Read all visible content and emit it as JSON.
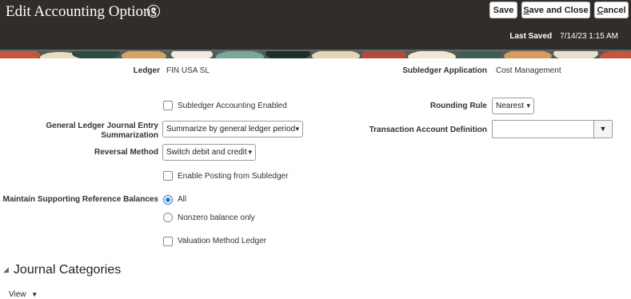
{
  "header": {
    "title": "Edit Accounting Options",
    "help_glyph": "?",
    "save": "Save",
    "save_close_accel": "S",
    "save_close_rest": "ave and Close",
    "cancel_accel": "C",
    "cancel_rest": "ancel",
    "last_saved_label": "Last Saved",
    "last_saved_value": "7/14/23 1:15 AM"
  },
  "form": {
    "ledger_label": "Ledger",
    "ledger_value": "FIN USA SL",
    "subledger_app_label": "Subledger Application",
    "subledger_app_value": "Cost Management",
    "subledger_accounting_enabled": "Subledger Accounting Enabled",
    "gl_summarization_label_1": "General Ledger Journal Entry",
    "gl_summarization_label_2": "Summarization",
    "gl_summarization_value": "Summarize by general ledger period",
    "reversal_method_label": "Reversal Method",
    "reversal_method_value": "Switch debit and credit",
    "enable_posting": "Enable Posting from Subledger",
    "maintain_balances_label": "Maintain Supporting Reference Balances",
    "balance_options": [
      "All",
      "Nonzero balance only"
    ],
    "balance_selected": "All",
    "valuation_method_ledger": "Valuation Method Ledger",
    "rounding_rule_label": "Rounding Rule",
    "rounding_rule_value": "Nearest",
    "tad_label": "Transaction Account Definition",
    "tad_value": ""
  },
  "section": {
    "title": "Journal Categories",
    "view_label": "View"
  },
  "colors": {
    "header_bg": "#312d2a",
    "radio_accent": "#227ae5"
  },
  "icons": [
    "help-icon",
    "chevron-down-icon",
    "collapse-triangle-icon",
    "dropdown-triangle-icon"
  ]
}
